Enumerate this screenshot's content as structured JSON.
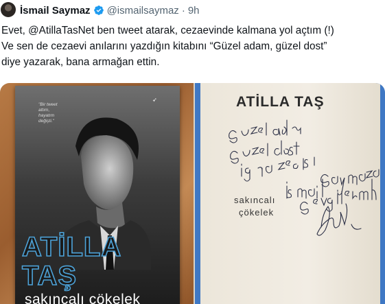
{
  "tweet": {
    "author_name": "İsmail Saymaz",
    "handle": "@ismailsaymaz",
    "separator": "·",
    "time": "9h",
    "text_lines": [
      "Evet, @AtillaTasNet ben tweet atarak, cezaevinde kalmana yol açtım (!)",
      "Ve sen de cezaevi anılarını yazdığın kitabını “Güzel adam, güzel dost”",
      "diye yazarak, bana armağan ettin."
    ]
  },
  "media": {
    "left_photo": {
      "cover_quote": "\"Bir tweet attım, hayatım değişti.\"",
      "author": "ATİLLA TAŞ",
      "title": "sakıncalı çökelek"
    },
    "right_photo": {
      "author": "ATİLLA TAŞ",
      "title_line1": "sakıncalı",
      "title_line2": "çökelek",
      "handwriting": [
        "Güzel adam",
        "güzel dost",
        "iyi gazeteci",
        "İsmail Saymaz'a",
        "Sevgilerimle"
      ]
    }
  },
  "colors": {
    "verified": "#1d9bf0",
    "secondary_text": "#536471",
    "author_outline": "#4da3d9",
    "binding_blue": "#3f78c4"
  },
  "icons": [
    "avatar",
    "verified-badge-icon"
  ]
}
